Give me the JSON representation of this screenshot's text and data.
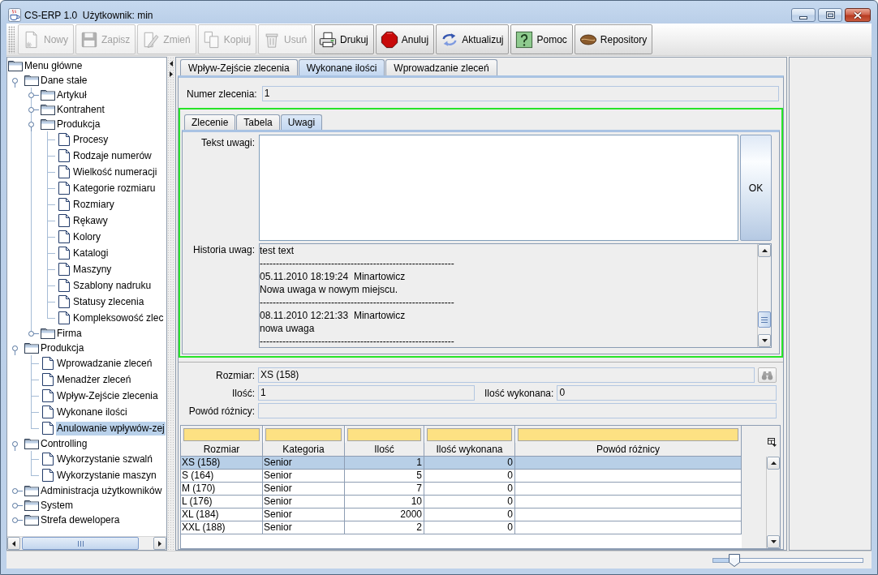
{
  "window": {
    "title": "CS-ERP 1.0  Użytkownik: min"
  },
  "toolbar": [
    {
      "kind": "new",
      "label": "Nowy",
      "disabled": true
    },
    {
      "kind": "save",
      "label": "Zapisz",
      "disabled": true
    },
    {
      "kind": "edit",
      "label": "Zmień",
      "disabled": true
    },
    {
      "kind": "copy",
      "label": "Kopiuj",
      "disabled": true
    },
    {
      "kind": "delete",
      "label": "Usuń",
      "disabled": true
    },
    {
      "kind": "print",
      "label": "Drukuj",
      "disabled": false
    },
    {
      "kind": "cancel",
      "label": "Anuluj",
      "disabled": false
    },
    {
      "kind": "refresh",
      "label": "Aktualizuj",
      "disabled": false
    },
    {
      "kind": "help",
      "label": "Pomoc",
      "disabled": false
    },
    {
      "kind": "repository",
      "label": "Repository",
      "disabled": false
    }
  ],
  "tree": {
    "items": [
      {
        "kind": "folder",
        "label": "Menu główne",
        "selected": false,
        "children": [
          {
            "kind": "folder",
            "label": "Dane stałe",
            "expanded": true,
            "selected": false,
            "children": [
              {
                "kind": "folder",
                "label": "Artykuł",
                "expanded": false,
                "selected": false
              },
              {
                "kind": "folder",
                "label": "Kontrahent",
                "expanded": false,
                "selected": false
              },
              {
                "kind": "folder",
                "label": "Produkcja",
                "expanded": true,
                "selected": false,
                "children": [
                  {
                    "kind": "leaf",
                    "label": "Procesy",
                    "selected": false
                  },
                  {
                    "kind": "leaf",
                    "label": "Rodzaje numerów",
                    "selected": false
                  },
                  {
                    "kind": "leaf",
                    "label": "Wielkość numeracji",
                    "selected": false
                  },
                  {
                    "kind": "leaf",
                    "label": "Kategorie rozmiaru",
                    "selected": false
                  },
                  {
                    "kind": "leaf",
                    "label": "Rozmiary",
                    "selected": false
                  },
                  {
                    "kind": "leaf",
                    "label": "Rękawy",
                    "selected": false
                  },
                  {
                    "kind": "leaf",
                    "label": "Kolory",
                    "selected": false
                  },
                  {
                    "kind": "leaf",
                    "label": "Katalogi",
                    "selected": false
                  },
                  {
                    "kind": "leaf",
                    "label": "Maszyny",
                    "selected": false
                  },
                  {
                    "kind": "leaf",
                    "label": "Szablony nadruku",
                    "selected": false
                  },
                  {
                    "kind": "leaf",
                    "label": "Statusy zlecenia",
                    "selected": false
                  },
                  {
                    "kind": "leaf",
                    "label": "Kompleksowość zlec",
                    "selected": false
                  }
                ]
              },
              {
                "kind": "folder",
                "label": "Firma",
                "expanded": false,
                "selected": false
              }
            ]
          },
          {
            "kind": "folder",
            "label": "Produkcja",
            "expanded": true,
            "selected": false,
            "children": [
              {
                "kind": "leaf",
                "label": "Wprowadzanie zleceń",
                "selected": false
              },
              {
                "kind": "leaf",
                "label": "Menadżer zleceń",
                "selected": false
              },
              {
                "kind": "leaf",
                "label": "Wpływ-Zejście zlecenia",
                "selected": false
              },
              {
                "kind": "leaf",
                "label": "Wykonane ilości",
                "selected": false
              },
              {
                "kind": "leaf",
                "label": "Anulowanie wpływów-zej",
                "selected": true
              }
            ]
          },
          {
            "kind": "folder",
            "label": "Controlling",
            "expanded": true,
            "selected": false,
            "children": [
              {
                "kind": "leaf",
                "label": "Wykorzystanie szwalń",
                "selected": false
              },
              {
                "kind": "leaf",
                "label": "Wykorzystanie maszyn",
                "selected": false
              }
            ]
          },
          {
            "kind": "folder",
            "label": "Administracja użytkowników",
            "expanded": false,
            "selected": false
          },
          {
            "kind": "folder",
            "label": "System",
            "expanded": false,
            "selected": false
          },
          {
            "kind": "folder",
            "label": "Strefa dewelopera",
            "expanded": false,
            "selected": false
          }
        ]
      }
    ]
  },
  "tabs": [
    {
      "label": "Wpływ-Zejście zlecenia",
      "selected": false
    },
    {
      "label": "Wykonane ilości",
      "selected": true
    },
    {
      "label": "Wprowadzanie zleceń",
      "selected": false
    }
  ],
  "order_number": {
    "label": "Numer zlecenia:",
    "value": "1"
  },
  "sub_tabs": [
    {
      "label": "Zlecenie",
      "selected": false
    },
    {
      "label": "Tabela",
      "selected": false
    },
    {
      "label": "Uwagi",
      "selected": true
    }
  ],
  "notes": {
    "text_label": "Tekst uwagi:",
    "ok_label": "OK",
    "history_label": "Historia uwag:",
    "history_lines": [
      "test text",
      "------------------------------------------------------------",
      "05.11.2010 18:19:24  Minartowicz",
      "Nowa uwaga w nowym miejscu.",
      "------------------------------------------------------------",
      "08.11.2010 12:21:33  Minartowicz",
      "nowa uwaga",
      "------------------------------------------------------------"
    ]
  },
  "detail": {
    "size_label": "Rozmiar:",
    "size_value": "XS (158)",
    "lookup_disabled": true,
    "quantity_label": "Ilość:",
    "quantity_value": "1",
    "done_label": "Ilość wykonana:",
    "done_value": "0",
    "reason_label": "Powód różnicy:"
  },
  "table": {
    "columns": [
      {
        "label": "Rozmiar",
        "kind": "text"
      },
      {
        "label": "Kategoria",
        "kind": "text"
      },
      {
        "label": "Ilość",
        "kind": "number"
      },
      {
        "label": "Ilość wykonana",
        "kind": "number"
      },
      {
        "label": "Powód różnicy",
        "kind": "text"
      }
    ],
    "rows": [
      {
        "selected": true,
        "cells": [
          "XS (158)",
          "Senior",
          "1",
          "0"
        ]
      },
      {
        "selected": false,
        "cells": [
          "S (164)",
          "Senior",
          "5",
          "0"
        ]
      },
      {
        "selected": false,
        "cells": [
          "M (170)",
          "Senior",
          "7",
          "0"
        ]
      },
      {
        "selected": false,
        "cells": [
          "L (176)",
          "Senior",
          "10",
          "0"
        ]
      },
      {
        "selected": false,
        "cells": [
          "XL (184)",
          "Senior",
          "2000",
          "0"
        ]
      },
      {
        "selected": false,
        "cells": [
          "XXL (188)",
          "Senior",
          "2",
          "0"
        ]
      }
    ]
  },
  "status_bar": {
    "slider": {
      "level": 0.14
    }
  }
}
